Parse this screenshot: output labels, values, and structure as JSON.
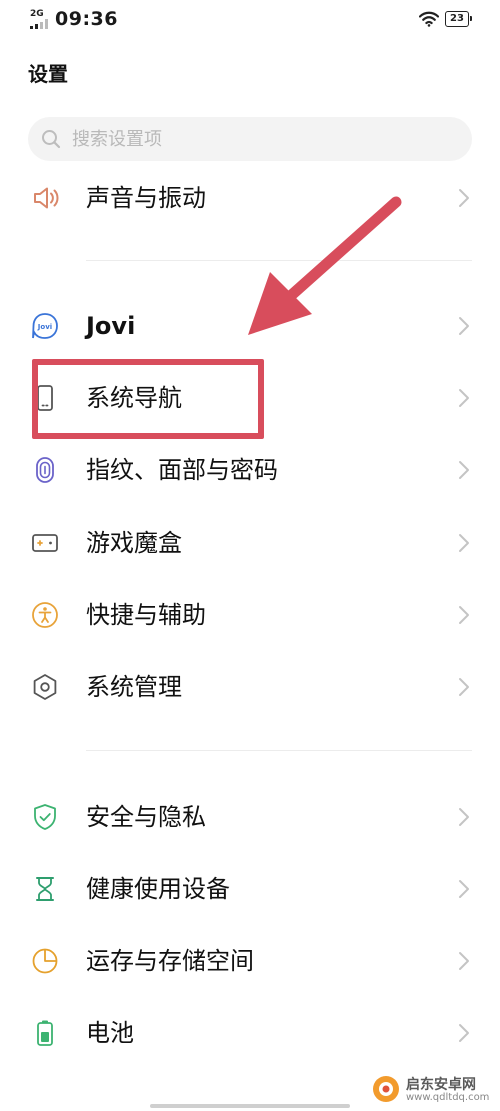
{
  "status_bar": {
    "network": "2G",
    "time": "09:36",
    "battery": "23"
  },
  "page": {
    "title": "设置"
  },
  "search": {
    "placeholder": "搜索设置项"
  },
  "settings": {
    "sound": {
      "label": "声音与振动",
      "icon": "speaker-icon",
      "color": "#d9876a"
    },
    "jovi": {
      "label": "Jovi",
      "icon": "jovi-icon",
      "color": "#3a74d8"
    },
    "navigation": {
      "label": "系统导航",
      "icon": "phone-navigation-icon",
      "color": "#555555"
    },
    "security_unlock": {
      "label": "指纹、面部与密码",
      "icon": "fingerprint-icon",
      "color": "#6b63c9"
    },
    "game": {
      "label": "游戏魔盒",
      "icon": "gamepad-icon",
      "color": "#555555"
    },
    "accessibility": {
      "label": "快捷与辅助",
      "icon": "accessibility-icon",
      "color": "#e8a33a"
    },
    "management": {
      "label": "系统管理",
      "icon": "hexagon-settings-icon",
      "color": "#555555"
    },
    "privacy": {
      "label": "安全与隐私",
      "icon": "shield-icon",
      "color": "#3cb371"
    },
    "health": {
      "label": "健康使用设备",
      "icon": "hourglass-icon",
      "color": "#2e9e6e"
    },
    "storage": {
      "label": "运存与存储空间",
      "icon": "pie-chart-icon",
      "color": "#e5a12d"
    },
    "battery": {
      "label": "电池",
      "icon": "battery-icon",
      "color": "#3cb371"
    }
  },
  "annotation": {
    "highlight_color": "#d84d5c",
    "target": "系统导航"
  },
  "watermark": {
    "name": "启东安卓网",
    "url": "www.qdltdq.com"
  }
}
